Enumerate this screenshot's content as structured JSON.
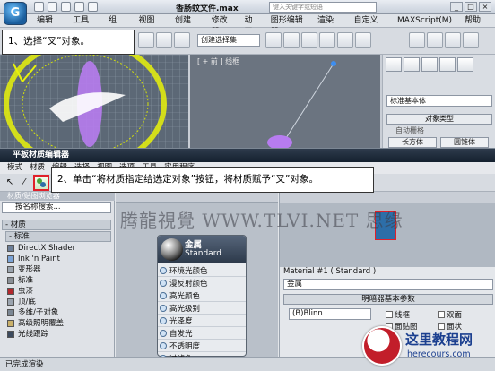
{
  "max_window": {
    "logo_glyph": "G",
    "title": "香肠蚊文件.max",
    "search_placeholder": "键入关键字或短语",
    "menus": [
      "编辑(E)",
      "工具(T)",
      "组(G)",
      "视图(V)",
      "创建(C)",
      "修改器",
      "动画",
      "图形编辑器",
      "渲染(R)",
      "自定义(U)",
      "MAXScript(M)",
      "帮助(H)"
    ],
    "selection_set_placeholder": "创建选择集",
    "viewport_front_label": "[ + 前 ] 线框"
  },
  "command_panel": {
    "object_category": "标准基本体",
    "rollout_title": "对象类型",
    "autogrid_label": "自动栅格",
    "buttons": [
      "长方体",
      "圆锥体"
    ]
  },
  "callouts": {
    "step1": "1、选择“叉”对象。",
    "step2": "2、单击“将材质指定给选定对象”按钮，将材质赋予“叉”对象。"
  },
  "slate_editor": {
    "title": "平板材质编辑器",
    "menus": [
      "模式",
      "材质",
      "编辑",
      "选择",
      "视图",
      "选项",
      "工具",
      "实用程序"
    ],
    "browser": {
      "title": "材质/贴图浏览器",
      "search_placeholder": "按名称搜索...",
      "category_materials": "- 材质",
      "category_standard": "- 标准",
      "items": [
        {
          "label": "DirectX Shader",
          "swatch": "#6d7f99"
        },
        {
          "label": "Ink 'n Paint",
          "swatch": "#7aa2d6"
        },
        {
          "label": "变形器",
          "swatch": "#9aa3ae"
        },
        {
          "label": "标准",
          "swatch": "#8a8f96"
        },
        {
          "label": "虫漆",
          "swatch": "#b3282d"
        },
        {
          "label": "顶/底",
          "swatch": "#9aa3ae"
        },
        {
          "label": "多维/子对象",
          "swatch": "#7b8794"
        },
        {
          "label": "高级照明覆盖",
          "swatch": "#c9b06a"
        },
        {
          "label": "光线跟踪",
          "swatch": "#3c4a5e"
        }
      ]
    },
    "node": {
      "title": "金属",
      "subtitle": "Standard",
      "slots": [
        "环境光颜色",
        "漫反射颜色",
        "高光颜色",
        "高光级别",
        "光泽度",
        "自发光",
        "不透明度",
        "过滤色"
      ]
    },
    "watermark": "腾龍視覺 WWW.TLVI.NET 思缘",
    "params": {
      "header": "Material #1  ( Standard )",
      "name_value": "金属",
      "rollout": "明暗器基本参数",
      "shader": "(B)Blinn",
      "checkbox_wire": "线框",
      "checkbox_2sided": "双面",
      "checkbox_facemap": "面贴图",
      "checkbox_faceted": "面状"
    },
    "status": "已完成渲染"
  },
  "logo": {
    "title": "这里教程网",
    "url": "herecours.com"
  },
  "colors": {
    "highlight_red": "#e0202a",
    "accent_blue": "#2d6ea8"
  }
}
